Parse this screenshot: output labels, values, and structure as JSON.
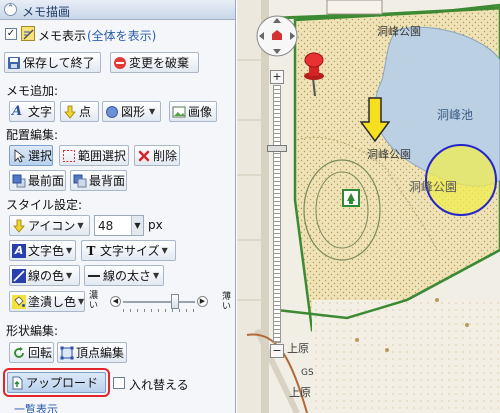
{
  "panel": {
    "title": "メモ描画",
    "memo_display_label": "メモ表示",
    "memo_display_link": "(全体を表示)",
    "memo_display_checked": true,
    "save_label": "保存して終了",
    "discard_label": "変更を破棄",
    "add_section": "メモ追加:",
    "add_buttons": {
      "text": "文字",
      "point": "点",
      "shape": "図形",
      "image": "画像"
    },
    "arrange_section": "配置編集:",
    "arrange_buttons": {
      "select": "選択",
      "range_select": "範囲選択",
      "delete": "削除",
      "front": "最前面",
      "back": "最背面"
    },
    "style_section": "スタイル設定:",
    "style": {
      "icon_label": "アイコン",
      "size_value": "48",
      "size_unit": "px",
      "text_color": "文字色",
      "text_size": "文字サイズ",
      "line_color": "線の色",
      "line_width": "線の太さ",
      "fill_color": "塗潰し色",
      "slider_left": "濃い",
      "slider_right": "薄い",
      "slider_level": 0.72
    },
    "shape_section": "形状編集:",
    "shape_buttons": {
      "rotate": "回転",
      "vertex": "頂点編集"
    },
    "upload_label": "アップロード",
    "swap_label": "入れ替える",
    "swap_checked": false,
    "footer_link": "一覧表示"
  },
  "map": {
    "labels": {
      "park_top": "洞峰公園",
      "park_center": "洞峰公園",
      "pond": "洞峰池",
      "park_right": "洞峰公園",
      "place_left": "上原",
      "place_bottom": "上原",
      "gs": "GS"
    }
  },
  "colors": {
    "accent": "#e0252b",
    "header": "#c9d7e9",
    "park_boundary": "#3d8a34",
    "pond": "#bcd0e4",
    "circle_fill": "#f0ec4f",
    "circle_stroke": "#2626c8"
  }
}
